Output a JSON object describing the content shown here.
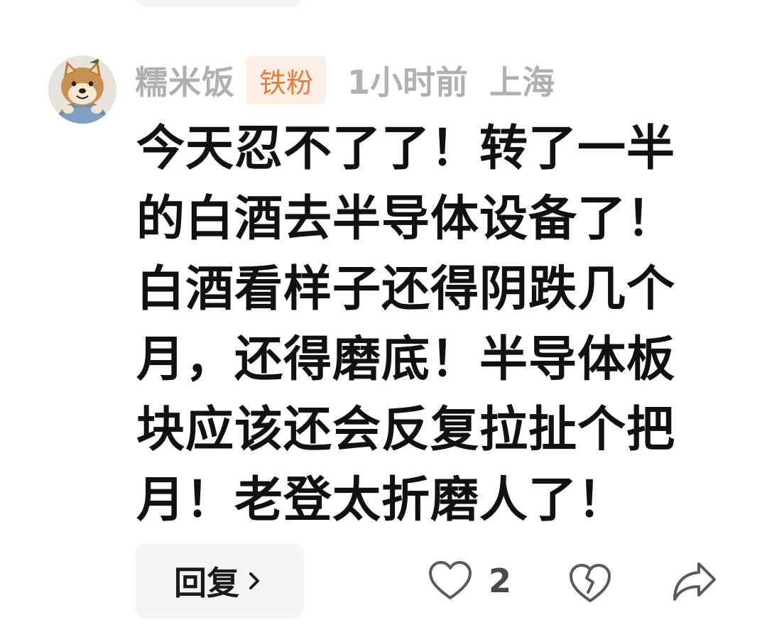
{
  "comment": {
    "username": "糯米饭",
    "badge": "铁粉",
    "time": "1小时前",
    "location": "上海",
    "text_lines": [
      "今天忍不了了！转了一半",
      "的白酒去半导体设备了！",
      "白酒看样子还得阴跌几个",
      "月，还得磨底！半导体板",
      "块应该还会反复拉扯个把",
      "月！老登太折磨人了！"
    ],
    "like_count": "2",
    "avatar_icon": "shiba-dog-avatar"
  },
  "actions": {
    "reply_label": "回复",
    "like_icon": "heart-outline-icon",
    "dislike_icon": "broken-heart-icon",
    "share_icon": "share-arrow-icon",
    "chevron_icon": "chevron-right-icon"
  },
  "colors": {
    "meta_gray": "#b0b0b0",
    "badge_bg": "#fdeee3",
    "badge_text": "#e87c3e",
    "body_text": "#111111",
    "button_bg": "#f5f5f5",
    "icon_gray": "#5a5a5a"
  }
}
